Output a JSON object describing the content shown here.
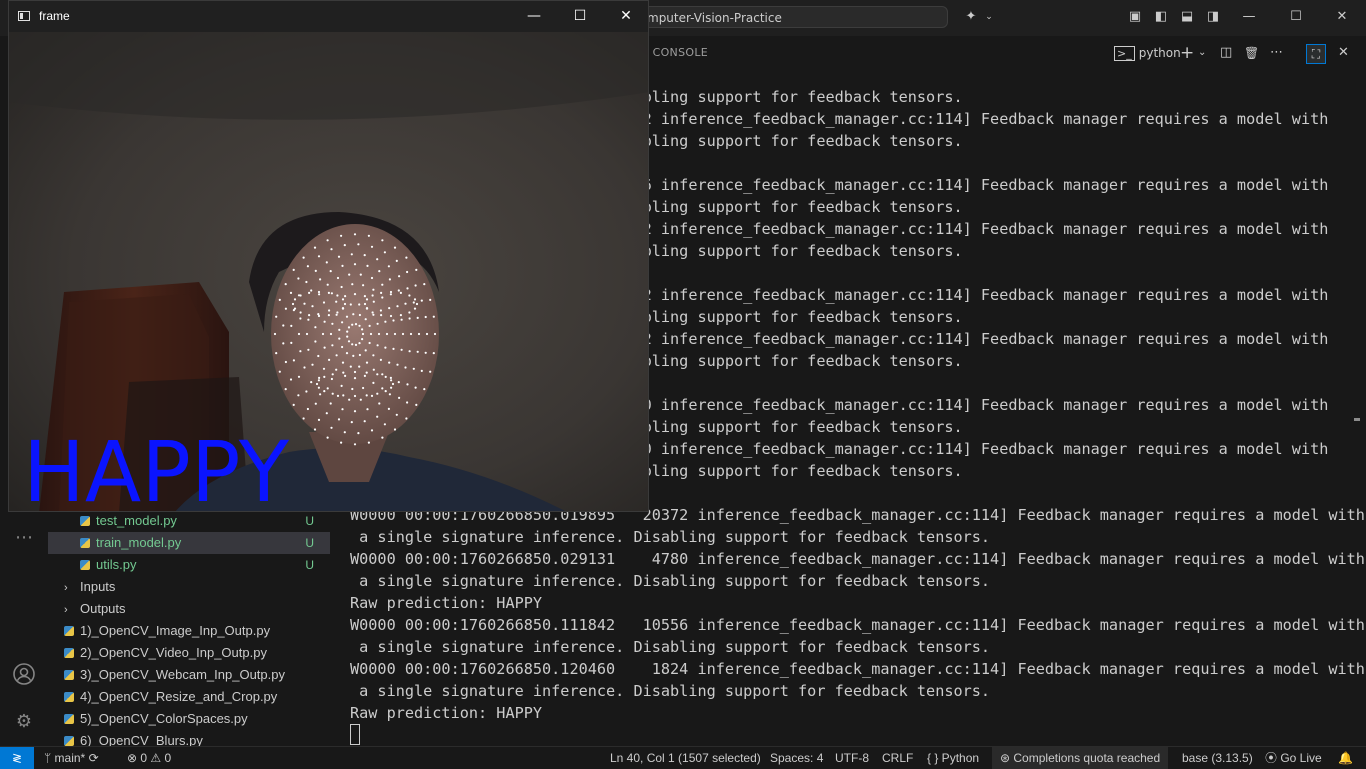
{
  "vscode": {
    "command_center": {
      "text": "mputer-Vision-Practice"
    },
    "title_icons": [
      "copilot-icon",
      "layout-customize-icon",
      "toggle-sidebar-icon",
      "toggle-panel-icon",
      "toggle-secondary-sidebar-icon"
    ],
    "window_controls": {
      "minimize": "—",
      "maximize": "☐",
      "close": "✕"
    },
    "activity_icons": [
      "more-icon",
      "accounts-icon",
      "manage-gear-icon"
    ],
    "explorer": {
      "items": [
        {
          "label": "test_model.py",
          "badge": "U",
          "kind": "file",
          "modified": true,
          "selected": false,
          "indent": 1
        },
        {
          "label": "train_model.py",
          "badge": "U",
          "kind": "file",
          "modified": true,
          "selected": true,
          "indent": 1
        },
        {
          "label": "utils.py",
          "badge": "U",
          "kind": "file",
          "modified": true,
          "selected": false,
          "indent": 1
        },
        {
          "label": "Inputs",
          "badge": "",
          "kind": "folder",
          "modified": false,
          "selected": false,
          "indent": 0
        },
        {
          "label": "Outputs",
          "badge": "",
          "kind": "folder",
          "modified": false,
          "selected": false,
          "indent": 0
        },
        {
          "label": "1)_OpenCV_Image_Inp_Outp.py",
          "badge": "",
          "kind": "file",
          "modified": false,
          "selected": false,
          "indent": 0
        },
        {
          "label": "2)_OpenCV_Video_Inp_Outp.py",
          "badge": "",
          "kind": "file",
          "modified": false,
          "selected": false,
          "indent": 0
        },
        {
          "label": "3)_OpenCV_Webcam_Inp_Outp.py",
          "badge": "",
          "kind": "file",
          "modified": false,
          "selected": false,
          "indent": 0
        },
        {
          "label": "4)_OpenCV_Resize_and_Crop.py",
          "badge": "",
          "kind": "file",
          "modified": false,
          "selected": false,
          "indent": 0
        },
        {
          "label": "5)_OpenCV_ColorSpaces.py",
          "badge": "",
          "kind": "file",
          "modified": false,
          "selected": false,
          "indent": 0
        },
        {
          "label": "6)_OpenCV_Blurs.py",
          "badge": "",
          "kind": "file",
          "modified": false,
          "selected": false,
          "indent": 0
        }
      ]
    },
    "panel": {
      "tab_label": "G CONSOLE",
      "terminal_name": "python",
      "actions": {
        "new": "+",
        "new_dropdown": "⌄",
        "split": "◫",
        "kill": "🗑",
        "more": "⋯"
      }
    },
    "terminal_lines": [
      "                              sabling support for feedback tensors.",
      "                             9672 inference_feedback_manager.cc:114] Feedback manager requires a model with",
      "                              sabling support for feedback tensors.",
      "",
      "                             8456 inference_feedback_manager.cc:114] Feedback manager requires a model with",
      "                              sabling support for feedback tensors.",
      "                             8832 inference_feedback_manager.cc:114] Feedback manager requires a model with",
      "                              sabling support for feedback tensors.",
      "",
      "                             2552 inference_feedback_manager.cc:114] Feedback manager requires a model with",
      "                              sabling support for feedback tensors.",
      "                             7372 inference_feedback_manager.cc:114] Feedback manager requires a model with",
      "                              sabling support for feedback tensors.",
      "",
      "                             4160 inference_feedback_manager.cc:114] Feedback manager requires a model with",
      "                              sabling support for feedback tensors.",
      "                             0640 inference_feedback_manager.cc:114] Feedback manager requires a model with",
      "                              sabling support for feedback tensors.",
      "",
      "W0000 00:00:1760266850.019895   20372 inference_feedback_manager.cc:114] Feedback manager requires a model with",
      " a single signature inference. Disabling support for feedback tensors.",
      "W0000 00:00:1760266850.029131    4780 inference_feedback_manager.cc:114] Feedback manager requires a model with",
      " a single signature inference. Disabling support for feedback tensors.",
      "Raw prediction: HAPPY",
      "W0000 00:00:1760266850.111842   10556 inference_feedback_manager.cc:114] Feedback manager requires a model with",
      " a single signature inference. Disabling support for feedback tensors.",
      "W0000 00:00:1760266850.120460    1824 inference_feedback_manager.cc:114] Feedback manager requires a model with",
      " a single signature inference. Disabling support for feedback tensors.",
      "Raw prediction: HAPPY"
    ],
    "status_bar": {
      "remote": "≷",
      "branch": "main*",
      "sync": "⟳",
      "problems": "⊗ 0 ⚠ 0",
      "cursor": "Ln 40, Col 1 (1507 selected)",
      "spaces": "Spaces: 4",
      "encoding": "UTF-8",
      "eol": "CRLF",
      "language": "{ } Python",
      "copilot": "Completions quota reached",
      "interpreter": "base (3.13.5)",
      "go_live": "Go Live",
      "bell": "🔔"
    }
  },
  "cv_window": {
    "title": "frame",
    "prediction_label": "HAPPY",
    "label_color": "#0a14ff",
    "controls": {
      "minimize": "—",
      "maximize": "☐",
      "close": "✕"
    }
  }
}
